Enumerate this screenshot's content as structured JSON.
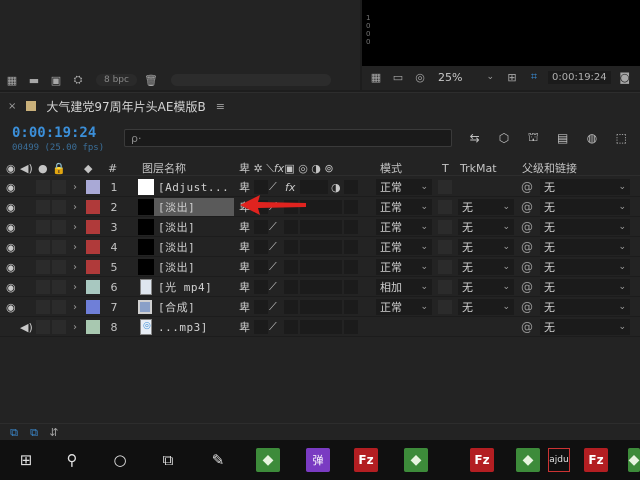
{
  "project_panel": {
    "bpc_label": "8 bpc"
  },
  "viewer": {
    "ruler_text": "1\n0\n0\n0",
    "zoom": "25%",
    "timecode": "0:00:19:24"
  },
  "timeline": {
    "tab_title": "大气建党97周年片头AE模版B",
    "tab_menu": "≡",
    "current_time": "0:00:19:24",
    "frame_info": "00499 (25.00 fps)",
    "search_placeholder": "ρ·",
    "headers": {
      "number": "#",
      "layer_name": "图层名称",
      "mode": "模式",
      "t": "T",
      "trkmat": "TrkMat",
      "parent": "父级和链接"
    },
    "layers": [
      {
        "num": "1",
        "name": "[Adjust...",
        "label_color": "#a9a9d6",
        "thumb": "white",
        "mode": "正常",
        "trkmat": "",
        "parent": "无",
        "has_eye": true,
        "fx": true,
        "selected": false
      },
      {
        "num": "2",
        "name": "[淡出]",
        "label_color": "#b03a3a",
        "thumb": "black",
        "mode": "正常",
        "trkmat": "无",
        "parent": "无",
        "has_eye": true,
        "fx": false,
        "selected": true
      },
      {
        "num": "3",
        "name": "[淡出]",
        "label_color": "#b03a3a",
        "thumb": "black",
        "mode": "正常",
        "trkmat": "无",
        "parent": "无",
        "has_eye": true,
        "fx": false,
        "selected": false
      },
      {
        "num": "4",
        "name": "[淡出]",
        "label_color": "#b03a3a",
        "thumb": "black",
        "mode": "正常",
        "trkmat": "无",
        "parent": "无",
        "has_eye": true,
        "fx": false,
        "selected": false
      },
      {
        "num": "5",
        "name": "[淡出]",
        "label_color": "#b03a3a",
        "thumb": "black",
        "mode": "正常",
        "trkmat": "无",
        "parent": "无",
        "has_eye": true,
        "fx": false,
        "selected": false
      },
      {
        "num": "6",
        "name": "[光 mp4]",
        "label_color": "#a8c8c0",
        "thumb": "file",
        "mode": "相加",
        "trkmat": "无",
        "parent": "无",
        "has_eye": true,
        "fx": false,
        "selected": false
      },
      {
        "num": "7",
        "name": "[合成]",
        "label_color": "#6f7fd8",
        "thumb": "comp",
        "mode": "正常",
        "trkmat": "无",
        "parent": "无",
        "has_eye": true,
        "fx": false,
        "selected": false
      },
      {
        "num": "8",
        "name": "...mp3]",
        "label_color": "#a8c8b0",
        "thumb": "audio",
        "mode": "",
        "trkmat": "",
        "parent": "无",
        "has_eye": false,
        "fx": false,
        "selected": false
      }
    ]
  },
  "taskbar": {
    "items": [
      {
        "name": "start-button",
        "glyph": "⊞"
      },
      {
        "name": "search-button",
        "glyph": "⚲"
      },
      {
        "name": "cortana-button",
        "glyph": "○"
      },
      {
        "name": "task-view-button",
        "glyph": "⧉"
      },
      {
        "name": "app-paint",
        "glyph": "✎"
      },
      {
        "name": "app-green-1",
        "glyph": "◆"
      },
      {
        "name": "app-danmu",
        "glyph": "弹"
      },
      {
        "name": "app-filezilla-1",
        "glyph": "Fz"
      },
      {
        "name": "app-green-2",
        "glyph": "◆"
      },
      {
        "name": "app-filezilla-2",
        "glyph": "Fz"
      },
      {
        "name": "app-green-3",
        "glyph": "◆"
      },
      {
        "name": "app-adobe",
        "glyph": "ajdu"
      },
      {
        "name": "app-filezilla-3",
        "glyph": "Fz"
      },
      {
        "name": "app-green-4",
        "glyph": "◆"
      }
    ]
  }
}
